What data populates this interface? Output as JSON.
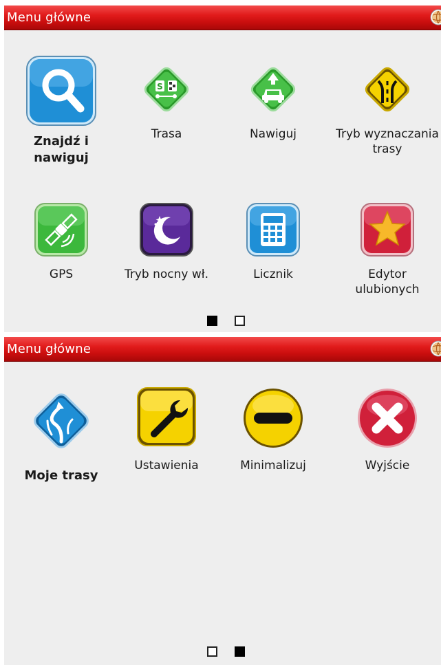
{
  "screens": [
    {
      "title": "Menu główne",
      "items": [
        {
          "label": "Znajdź i nawiguj",
          "icon": "search-icon"
        },
        {
          "label": "Trasa",
          "icon": "route-icon"
        },
        {
          "label": "Nawiguj",
          "icon": "navigate-car-icon"
        },
        {
          "label": "Tryb wyznaczania trasy",
          "icon": "road-sign-icon"
        },
        {
          "label": "GPS",
          "icon": "satellite-icon"
        },
        {
          "label": "Tryb nocny wł.",
          "icon": "moon-icon"
        },
        {
          "label": "Licznik",
          "icon": "calculator-icon"
        },
        {
          "label": "Edytor ulubionych",
          "icon": "star-icon"
        }
      ],
      "page_indicator": {
        "current": 1,
        "total": 2
      }
    },
    {
      "title": "Menu główne",
      "items": [
        {
          "label": "Moje trasy",
          "icon": "my-routes-icon"
        },
        {
          "label": "Ustawienia",
          "icon": "wrench-icon"
        },
        {
          "label": "Minimalizuj",
          "icon": "minus-icon"
        },
        {
          "label": "Wyjście",
          "icon": "close-icon"
        }
      ],
      "page_indicator": {
        "current": 2,
        "total": 2
      }
    }
  ],
  "colors": {
    "title_bar": "#e11b1b",
    "background": "#eeeeee",
    "search_blue": "#1f8fd6",
    "green": "#3cb83c",
    "yellow": "#f5d200",
    "purple": "#5a2a9a",
    "red": "#d0203a"
  }
}
